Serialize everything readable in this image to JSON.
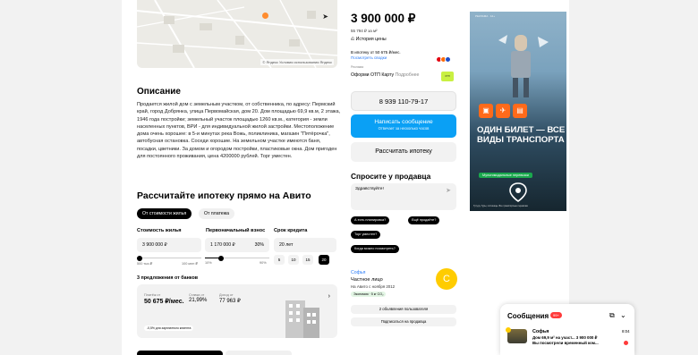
{
  "colors": {
    "accent_blue": "#0aa0f5",
    "link_blue": "#2a7cf7",
    "badge_red": "#ff3b3b",
    "avatar_yellow": "#ffcc00",
    "banner_orange": "#ff6a1a",
    "banner_green": "#1aa84d"
  },
  "map": {
    "copyright": "© Яндекс Условия использования Яндекс"
  },
  "description": {
    "title": "Описание",
    "text": "Продается жилой дом с земельным участком, от собственника, по адресу: Пермский край, город Добрянка, улица Первомайская, дом 20. Дом площадью 69,9 кв.м, 2 этажа, 1946 года постройки; земельный участок площадью 1260 кв.м., категория - земли населенных пунктов, ВРИ - для индивидуальной жилой застройки. Местоположение дома очень хорошее: в 5-и минутах река Вожь, поликлиника, магазин \"Пятёрочка\", автобусная остановка. Соседи хорошие. На земельном участке имеются баня, посадки, цветники. За домом и огородом постройки, пластиковые окна. Дом пригоден для постоянного проживания, цена 4200000 рублей. Торг уместен."
  },
  "mortgage": {
    "title": "Рассчитайте ипотеку прямо на Авито",
    "tab_active": "От стоимости жилья",
    "tab_inactive": "От платежа",
    "cost_label": "Стоимость жилья",
    "cost_value": "3 900 000 ₽",
    "cost_min": "500 тыс.₽",
    "cost_max": "100 млн ₽",
    "cost_fraction": 0.04,
    "down_label": "Первоначальный взнос",
    "down_value": "1 170 000 ₽",
    "down_pct": "30%",
    "down_min": "10%",
    "down_max": "90%",
    "down_fraction": 0.25,
    "term_label": "Срок кредита",
    "term_value": "20 лет",
    "term_options": [
      "5",
      "10",
      "15",
      "20"
    ],
    "banks_title": "3 предложения от банков",
    "offer": {
      "pay_label": "Платёж от",
      "pay_value": "50 675 ₽/мес.",
      "rate_label": "Ставка от",
      "rate_value": "21,99%",
      "income_label": "Доход от",
      "income_value": "77 963 ₽",
      "note": "-0,5% для зарплатного клиента"
    }
  },
  "listing": {
    "price": "3 900 000 ₽",
    "price_per_m2": "55 794 ₽ за м²",
    "history": "История цены",
    "mortgage_line": "В ипотеку от 50 675 ₽/мес.",
    "mortgage_link": "Посмотреть сводки",
    "ad_label": "Реклама",
    "ad_text": "Оформи ОТП Карту",
    "ad_more": "Подробнее",
    "ad_logo": "ОТП",
    "phone": "8 939 110-79-17",
    "write_btn": "Написать сообщение",
    "write_sub": "Отвечает за несколько часов",
    "calc_btn": "Рассчитать ипотеку",
    "ask_title": "Спросите у продавца",
    "ask_placeholder": "Здравствуйте!",
    "chips": [
      "А есть планировка?",
      "Ещё продаёте?",
      "Торг уместен?",
      "Когда можно посмотреть?"
    ]
  },
  "seller": {
    "name": "Софья",
    "type": "Частное лицо",
    "since": "На Авито с ноября 2012",
    "badge": "Экономия · 5 кг CO₂",
    "avatar_letter": "С",
    "ads_btn": "2 объявления пользователя",
    "subscribe_btn": "Подписаться на продавца"
  },
  "banner": {
    "top": "РЕКЛАМА · 12+",
    "title": "ОДИН БИЛЕТ — ВСЕ ВИДЫ ТРАНСПОРТА",
    "chip": "Мультимодальные перевозки",
    "foot": "Туту.ру. Туры, гостиницы. Все транспортные перевозки"
  },
  "messages": {
    "title": "Сообщения",
    "badge": "99+",
    "name": "Софья",
    "time": "8:04",
    "line1": "Дом 69,9 м² на участ... 3 900 000 ₽",
    "line2": "Вы посмотрели временный ком..."
  }
}
